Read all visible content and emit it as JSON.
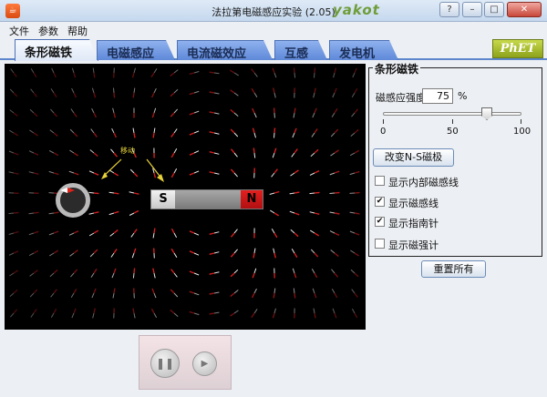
{
  "window": {
    "title": "法拉第电磁感应实验 (2.05)",
    "app_icon_glyph": "☕",
    "wm_logo": "yakot",
    "buttons": {
      "help": "?",
      "minimize": "–",
      "maximize": "□",
      "close": "✕"
    }
  },
  "menu": {
    "items": [
      "文件",
      "参数",
      "帮助"
    ]
  },
  "tabs": {
    "items": [
      "条形磁铁",
      "电磁感应",
      "电流磁效应",
      "互感",
      "发电机"
    ],
    "active_index": 0,
    "logo": "PhET"
  },
  "canvas": {
    "move_hint": "移动",
    "magnet": {
      "south": "S",
      "north": "N"
    },
    "colors": {
      "background": "#000000",
      "field_arrow": "#e8e8e8",
      "field_arrow_tip": "#d42020",
      "hint": "#e8d23a"
    }
  },
  "panel": {
    "title": "条形磁铁",
    "strength_label": "磁感应强度",
    "strength_value": "75",
    "strength_unit": "%",
    "slider": {
      "min": 0,
      "max": 100,
      "value": 75,
      "tick_labels": [
        "0",
        "50",
        "100"
      ]
    },
    "flip_button": "改变N-S磁极",
    "checkboxes": [
      {
        "label": "显示内部磁感线",
        "checked": false
      },
      {
        "label": "显示磁感线",
        "checked": true
      },
      {
        "label": "显示指南针",
        "checked": true
      },
      {
        "label": "显示磁强计",
        "checked": false
      }
    ]
  },
  "reset_button": "重置所有",
  "playback": {
    "pause_icon": "❚❚",
    "step_icon": "▶"
  }
}
